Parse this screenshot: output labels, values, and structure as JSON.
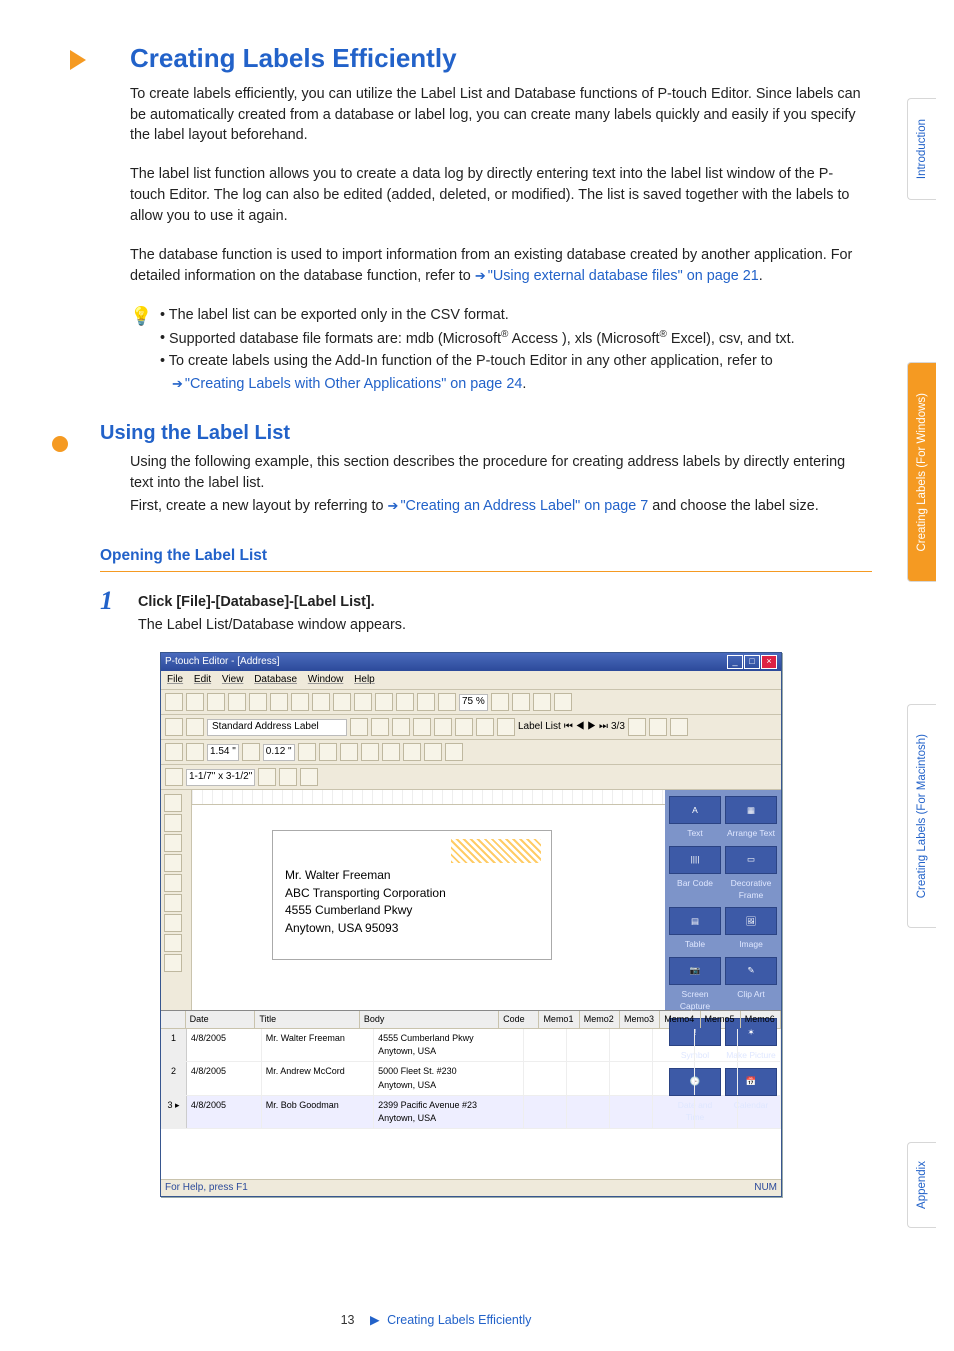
{
  "sidebar": {
    "tabs": [
      {
        "label": "Introduction",
        "active": false
      },
      {
        "label": "Creating Labels (For Windows)",
        "active": true
      },
      {
        "label": "Creating Labels (For Macintosh)",
        "active": false
      },
      {
        "label": "Appendix",
        "active": false
      }
    ]
  },
  "heading": "Creating Labels Efficiently",
  "intro": {
    "p1": "To create labels efficiently, you can utilize the Label List and Database functions of P-touch Editor. Since labels can be automatically created from a database or label log, you can create many labels quickly and easily if you specify the label layout beforehand.",
    "p2": "The label list function allows you to create a data log by directly entering text into the label list window of the P-touch Editor. The log can also be edited (added, deleted, or modified). The list is saved together with the labels to allow you to use it again.",
    "p3a": "The database function is used to import information from an existing database created by another application. For detailed information on the database function, refer to ",
    "p3link": "\"Using external database files\" on page 21",
    "p3b": "."
  },
  "tip": {
    "l1": "The label list can be exported only in the CSV format.",
    "l2a": "Supported database file formats are: mdb (Microsoft",
    "l2b": " Access ), xls (Microsoft",
    "l2c": " Excel), csv, and txt.",
    "l3": "To create labels using the Add-In function of the P-touch Editor in any other application, refer to",
    "l3link": "\"Creating Labels with Other Applications\" on page 24",
    "l3b": "."
  },
  "sec2": "Using the Label List",
  "sec2p1a": "Using the following example, this section describes the procedure for creating address labels by directly entering text into the label list.",
  "sec2p1b_a": "First, create a new layout by referring to ",
  "sec2p1b_link": "\"Creating an Address Label\" on page 7",
  "sec2p1b_b": " and choose the label size.",
  "sub1": "Opening the Label List",
  "step1": {
    "num": "1",
    "cmd": "Click [File]-[Database]-[Label List].",
    "desc": "The Label List/Database window appears."
  },
  "shot": {
    "title": "P-touch Editor - [Address]",
    "menus": [
      "File",
      "Edit",
      "View",
      "Database",
      "Window",
      "Help"
    ],
    "propname": "Standard Address Label",
    "labellist_label": "Label List",
    "nav": "3/3",
    "size": "1-1/7\" x 3-1/2\"",
    "margin": "0.12 \"",
    "label": {
      "l1": "Mr. Walter Freeman",
      "l2": "ABC Transporting Corporation",
      "l3": "4555 Cumberland Pkwy",
      "l4": "Anytown, USA 95093"
    },
    "rp": [
      "Text",
      "Arrange Text",
      "Bar Code",
      "Decorative Frame",
      "Table",
      "Image",
      "Screen Capture",
      "Clip Art",
      "Symbol",
      "Make Picture",
      "Date and Time",
      "Calendar"
    ],
    "cols": [
      "Date",
      "Title",
      "Body",
      "Code",
      "Memo1",
      "Memo2",
      "Memo3",
      "Memo4",
      "Memo5",
      "Memo6"
    ],
    "rows": [
      {
        "n": "1",
        "date": "4/8/2005",
        "title": "Mr. Walter Freeman",
        "body1": "4555 Cumberland Pkwy",
        "body2": "Anytown, USA"
      },
      {
        "n": "2",
        "date": "4/8/2005",
        "title": "Mr. Andrew McCord",
        "body1": "5000 Fleet St. #230",
        "body2": "Anytown, USA"
      },
      {
        "n": "3",
        "date": "4/8/2005",
        "title": "Mr. Bob Goodman",
        "body1": "2399 Pacific Avenue #23",
        "body2": "Anytown, USA"
      }
    ],
    "status_left": "For Help, press F1",
    "status_right": "NUM"
  },
  "footer": {
    "page": "13",
    "section": "Creating Labels Efficiently"
  },
  "reg": "®"
}
